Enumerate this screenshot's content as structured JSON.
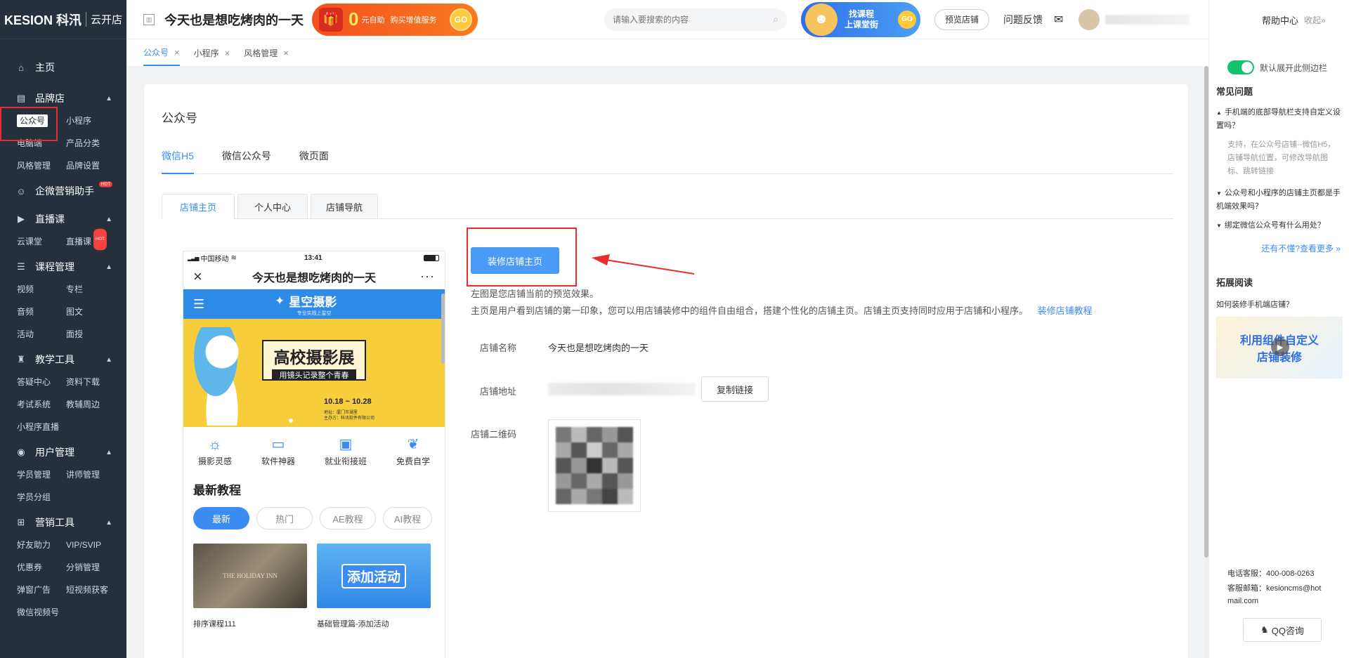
{
  "sidebar": {
    "brand": "KESION 科汛",
    "brand_sub": "云开店",
    "home": "主页",
    "sections": [
      {
        "label": "品牌店",
        "items": [
          "公众号",
          "小程序",
          "电脑端",
          "产品分类",
          "风格管理",
          "品牌设置"
        ]
      },
      {
        "label": "企微营销助手",
        "items": []
      },
      {
        "label": "直播课",
        "items": [
          "云课堂",
          "直播课"
        ]
      },
      {
        "label": "课程管理",
        "items": [
          "视频",
          "专栏",
          "音频",
          "图文",
          "活动",
          "面授"
        ]
      },
      {
        "label": "教学工具",
        "items": [
          "答疑中心",
          "资料下载",
          "考试系统",
          "教辅周边",
          "小程序直播"
        ]
      },
      {
        "label": "用户管理",
        "items": [
          "学员管理",
          "讲师管理",
          "学员分组"
        ]
      },
      {
        "label": "营销工具",
        "items": [
          "好友助力",
          "VIP/SVIP",
          "优惠券",
          "分销管理",
          "弹窗广告",
          "短视频获客",
          "微信视频号"
        ]
      }
    ],
    "hot": "HOT"
  },
  "topbar": {
    "store_name": "今天也是想吃烤肉的一天",
    "promo_zero": "0",
    "promo_text1": "元自助",
    "promo_text2": "购买增值服务",
    "promo_go": "GO",
    "search_placeholder": "请输入要搜索的内容",
    "banner_line1": "找课程",
    "banner_line2": "上课堂街",
    "banner_go": "GO",
    "preview_store": "预览店铺",
    "feedback": "问题反馈",
    "help_center": "帮助中心",
    "collapse": "收起»"
  },
  "tabs": [
    {
      "label": "公众号",
      "active": true
    },
    {
      "label": "小程序",
      "active": false
    },
    {
      "label": "风格管理",
      "active": false
    }
  ],
  "main": {
    "title": "公众号",
    "subtabs": [
      "微信H5",
      "微信公众号",
      "微页面"
    ],
    "boxtabs": [
      "店铺主页",
      "个人中心",
      "店铺导航"
    ],
    "decorate_button": "装修店铺主页",
    "desc1": "左图是您店铺当前的预览效果。",
    "desc2": "主页是用户看到店铺的第一印象，您可以用店铺装修中的组件自由组合，搭建个性化的店铺主页。店铺主页支持同时应用于店铺和小程序。",
    "desc_link": "装修店铺教程",
    "store_name_label": "店铺名称",
    "store_name_value": "今天也是想吃烤肉的一天",
    "store_addr_label": "店铺地址",
    "copy_link": "复制链接",
    "qr_label": "店铺二维码"
  },
  "phone": {
    "carrier": "中国移动",
    "time": "13:41",
    "title": "今天也是想吃烤肉的一天",
    "logo_text": "星空摄影",
    "logo_sub": "专业实践上星空",
    "banner_title": "高校摄影展",
    "banner_sub": "用镜头记录整个青春",
    "banner_date": "10.18 ~ 10.28",
    "banner_info1": "地址：厦门市湖里",
    "banner_info2": "主办方：科讯软件有限公司",
    "icons": [
      {
        "icon": "sun-icon",
        "label": "摄影灵感"
      },
      {
        "icon": "monitor-icon",
        "label": "软件神器"
      },
      {
        "icon": "briefcase-icon",
        "label": "就业衔接班"
      },
      {
        "icon": "leaf-icon",
        "label": "免费自学"
      }
    ],
    "section_title": "最新教程",
    "filters": [
      "最新",
      "热门",
      "AE教程",
      "AI教程"
    ],
    "cards": [
      "排序课程111",
      "基础管理篇-添加活动"
    ],
    "card2_overlay": "添加活动",
    "card1_overlay": "THE HOLIDAY INN"
  },
  "right_panel": {
    "toggle_label": "默认展开此侧边栏",
    "faq_title": "常见问题",
    "faq": [
      {
        "q": "手机端的底部导航栏支持自定义设置吗？",
        "a": "支持，在公众号店铺--微信H5，店铺导航位置，可修改导航图标、跳转链接",
        "open": true
      },
      {
        "q": "公众号和小程序的店铺主页都是手机端效果吗？",
        "a": "",
        "open": false
      },
      {
        "q": "绑定微信公众号有什么用处？",
        "a": "",
        "open": false
      }
    ],
    "more_link": "还有不懂?查看更多 »",
    "ext_title": "拓展阅读",
    "ext_item": "如何装修手机端店铺？",
    "video_text1": "利用组件自定义",
    "video_text2": "店铺装修",
    "phone_line": "电话客服：400-008-0263",
    "email_line1": "客服邮箱：kesioncms@hot",
    "email_line2": "mail.com",
    "qq_button": "QQ咨询"
  },
  "colors": {
    "accent": "#3b8cf2",
    "sidebar_bg": "#26303d",
    "highlight": "#e62e2e",
    "toggle": "#13c26b"
  }
}
